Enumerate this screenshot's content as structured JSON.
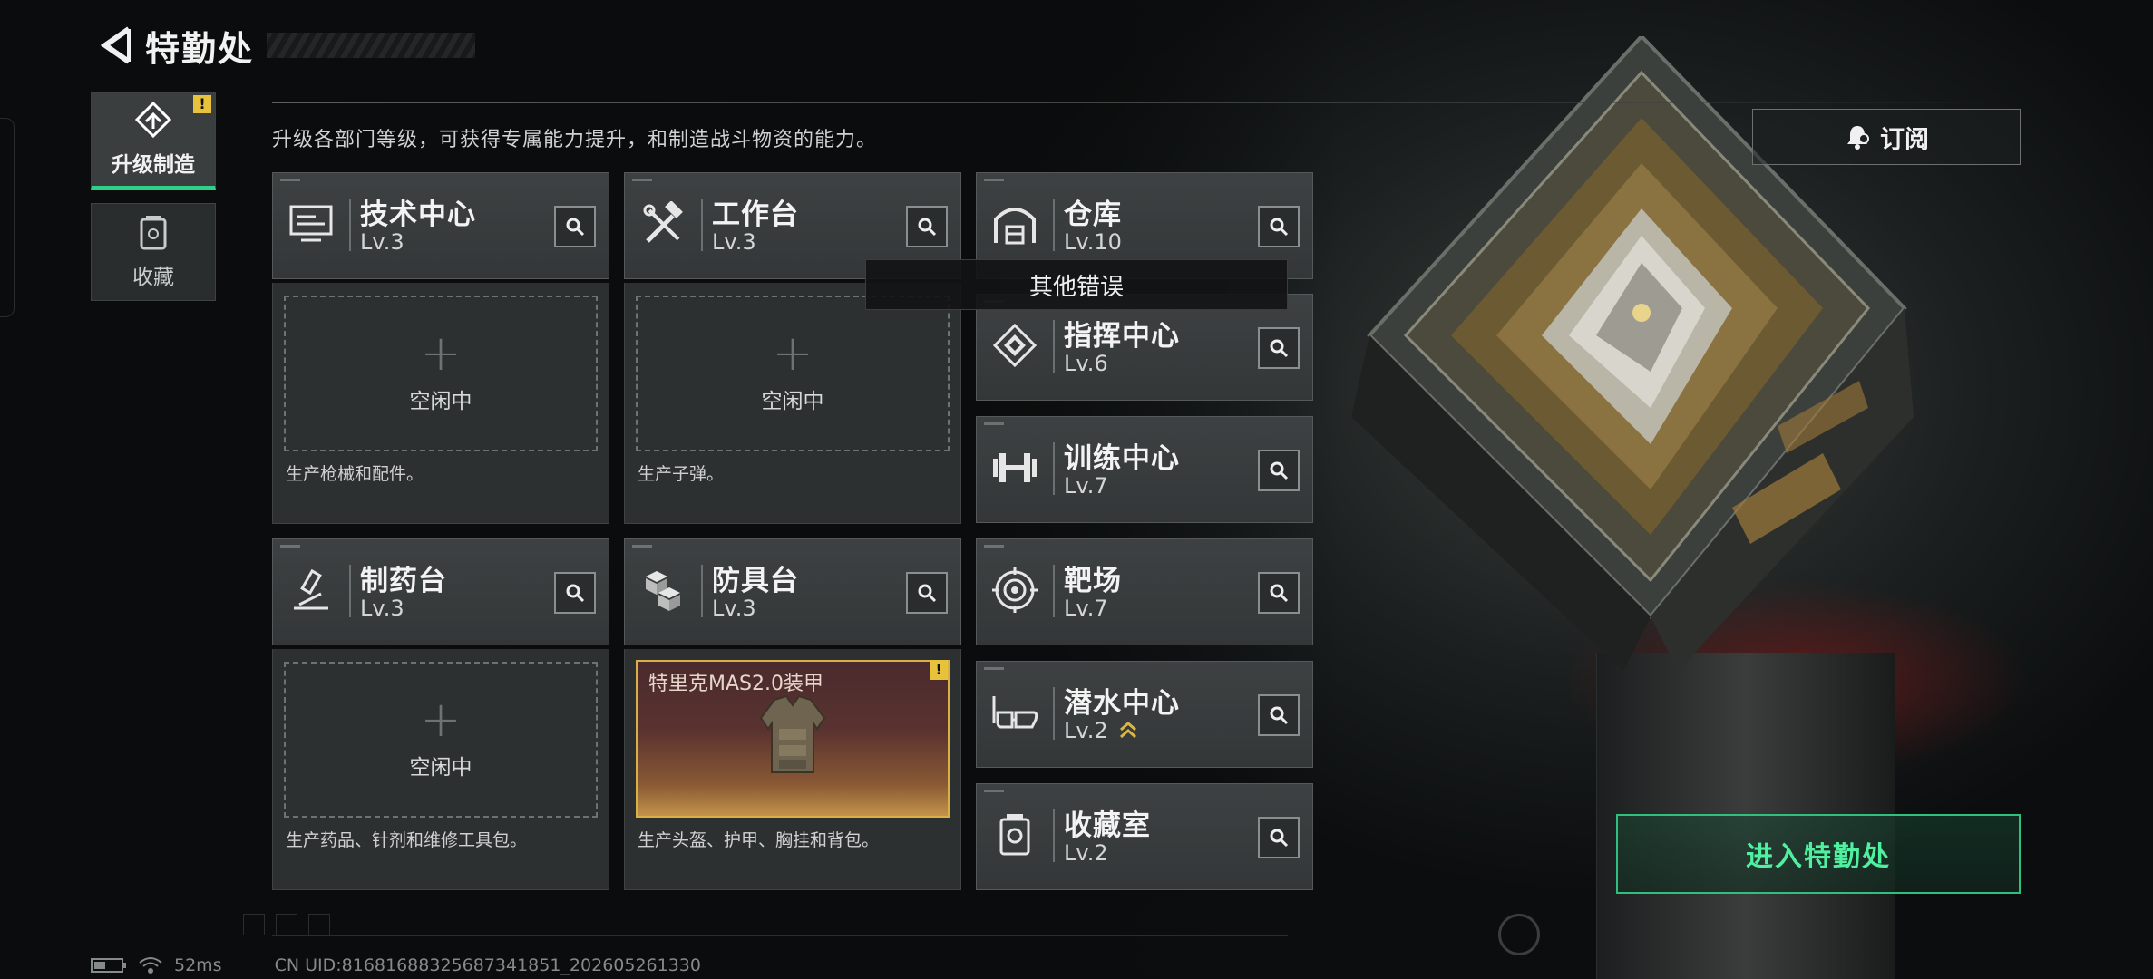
{
  "header": {
    "title": "特勤处"
  },
  "side_nav": [
    {
      "label": "升级制造",
      "active": true,
      "badge": "!"
    },
    {
      "label": "收藏",
      "active": false
    }
  ],
  "description": "升级各部门等级，可获得专属能力提升，和制造战斗物资的能力。",
  "subscribe": {
    "label": "订阅"
  },
  "departments": [
    {
      "name": "技术中心",
      "level": "Lv.3",
      "icon": "tech-icon"
    },
    {
      "name": "工作台",
      "level": "Lv.3",
      "icon": "tools-icon"
    },
    {
      "name": "仓库",
      "level": "Lv.10",
      "icon": "warehouse-icon"
    },
    {
      "name": "指挥中心",
      "level": "Lv.6",
      "icon": "command-icon"
    },
    {
      "name": "训练中心",
      "level": "Lv.7",
      "icon": "dumbbell-icon"
    },
    {
      "name": "制药台",
      "level": "Lv.3",
      "icon": "microscope-icon"
    },
    {
      "name": "防具台",
      "level": "Lv.3",
      "icon": "cubes-icon"
    },
    {
      "name": "靶场",
      "level": "Lv.7",
      "icon": "target-icon"
    },
    {
      "name": "潜水中心",
      "level": "Lv.2",
      "icon": "goggles-icon"
    },
    {
      "name": "收藏室",
      "level": "Lv.2",
      "icon": "collection-icon"
    }
  ],
  "production": {
    "idle_label": "空闲中",
    "tech": "生产枪械和配件。",
    "workbench": "生产子弹。",
    "pharmacy": "生产药品、针剂和维修工具包。",
    "armor": "生产头盔、护甲、胸挂和背包。",
    "armor_item": "特里克MAS2.0装甲",
    "armor_badge": "!"
  },
  "tooltip": "其他错误",
  "enter_button": "进入特勤处",
  "status_bar": {
    "ping": "52ms",
    "uid": "CN UID:8168168832568734185​1_202605261330"
  },
  "colors": {
    "accent": "#2ed08a",
    "warning": "#e8c23a",
    "enter_text": "#4ff0a0"
  }
}
